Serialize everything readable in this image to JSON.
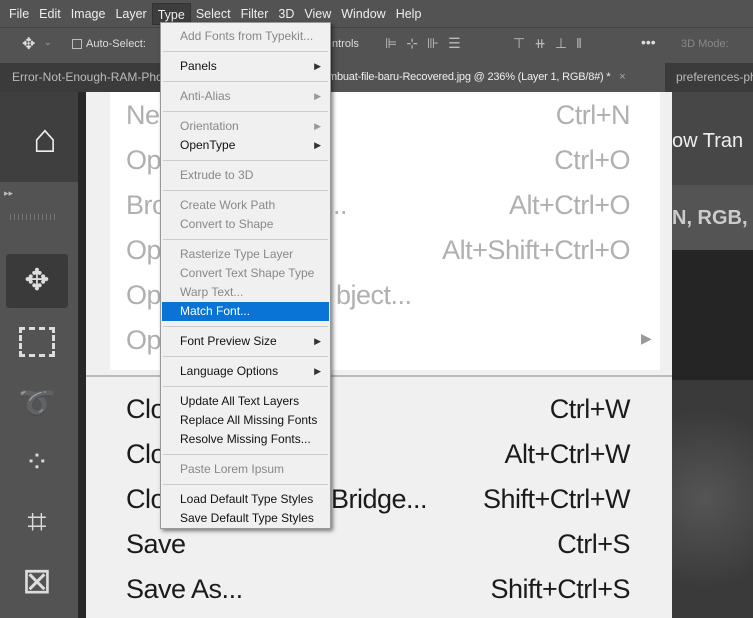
{
  "menubar": [
    "File",
    "Edit",
    "Image",
    "Layer",
    "Type",
    "Select",
    "Filter",
    "3D",
    "View",
    "Window",
    "Help"
  ],
  "options": {
    "auto_select": "Auto-Select:",
    "controls": "ntrols",
    "mode_3d": "3D Mode:"
  },
  "tabs": [
    {
      "label": "Error-Not-Enough-RAM-Pho"
    },
    {
      "label": "mbuat-file-baru-Recovered.jpg @ 236% (Layer 1, RGB/8#) *",
      "close": "×"
    },
    {
      "label": "preferences-ph"
    }
  ],
  "type_menu": [
    {
      "label": "Add Fonts from Typekit...",
      "disabled": true
    },
    {
      "sep": true
    },
    {
      "label": "Panels",
      "submenu": true
    },
    {
      "sep": true
    },
    {
      "label": "Anti-Alias",
      "disabled": true,
      "submenu": true
    },
    {
      "sep": true
    },
    {
      "label": "Orientation",
      "disabled": true,
      "submenu": true
    },
    {
      "label": "OpenType",
      "submenu": true
    },
    {
      "sep": true
    },
    {
      "label": "Extrude to 3D",
      "disabled": true
    },
    {
      "sep": true
    },
    {
      "label": "Create Work Path",
      "disabled": true
    },
    {
      "label": "Convert to Shape",
      "disabled": true
    },
    {
      "sep": true
    },
    {
      "label": "Rasterize Type Layer",
      "disabled": true
    },
    {
      "label": "Convert Text Shape Type",
      "disabled": true
    },
    {
      "label": "Warp Text...",
      "disabled": true
    },
    {
      "label": "Match Font...",
      "highlighted": true
    },
    {
      "sep": true
    },
    {
      "label": "Font Preview Size",
      "submenu": true
    },
    {
      "sep": true
    },
    {
      "label": "Language Options",
      "submenu": true
    },
    {
      "sep": true
    },
    {
      "label": "Update All Text Layers"
    },
    {
      "label": "Replace All Missing Fonts"
    },
    {
      "label": "Resolve Missing Fonts..."
    },
    {
      "sep": true
    },
    {
      "label": "Paste Lorem Ipsum",
      "disabled": true
    },
    {
      "sep": true
    },
    {
      "label": "Load Default Type Styles"
    },
    {
      "label": "Save Default Type Styles"
    }
  ],
  "canvas_image": {
    "upper": [
      {
        "left": "Ne",
        "right": "Ctrl+N"
      },
      {
        "left": "Op",
        "right": "Ctrl+O"
      },
      {
        "left": "Bro",
        "mid": "...",
        "right": "Alt+Ctrl+O"
      },
      {
        "left": "Op",
        "right": "Alt+Shift+Ctrl+O"
      },
      {
        "left": "Op",
        "mid": "bject...",
        "right": ""
      },
      {
        "left": "Op",
        "right": ""
      }
    ],
    "lower": [
      {
        "left": "Clo",
        "right": "Ctrl+W"
      },
      {
        "left": "Clo",
        "right": "Alt+Ctrl+W"
      },
      {
        "left": "Clo",
        "mid": "Bridge...",
        "right": "Shift+Ctrl+W"
      },
      {
        "left": "Save",
        "right": "Ctrl+S"
      },
      {
        "left": "Save As...",
        "right": "Shift+Ctrl+S"
      }
    ],
    "right_text_1": "ow Tran",
    "right_text_2": "N, RGB,"
  },
  "colors": {
    "highlight": "#0a74d6",
    "menu_bg": "#f0f0f0",
    "app_bg": "#535353"
  }
}
